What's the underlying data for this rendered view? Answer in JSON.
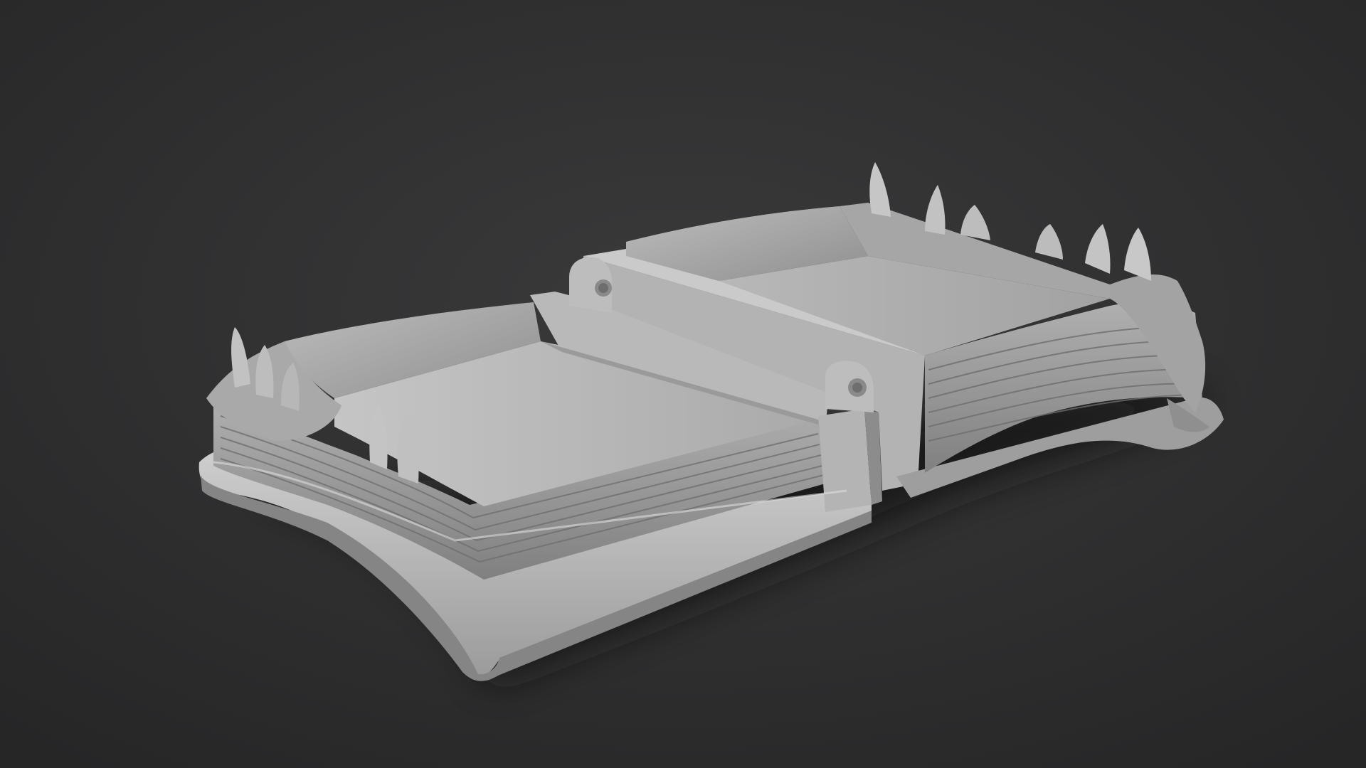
{
  "scene": {
    "subject": "open-book-box-3d-render",
    "colors": {
      "background_top": "#3a3a3b",
      "background_bottom": "#262627",
      "model_light": "#c9c9c9",
      "model_mid": "#a8a8a8",
      "model_dark": "#7e7e7e",
      "model_shadow": "#5f5f5f",
      "floor_shadow": "#121213"
    }
  }
}
